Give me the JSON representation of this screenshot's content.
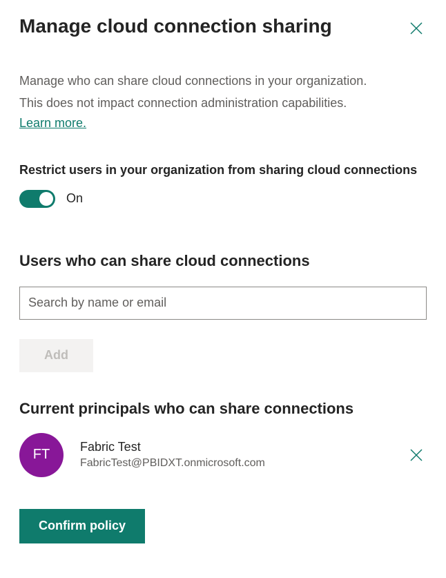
{
  "header": {
    "title": "Manage cloud connection sharing"
  },
  "description": {
    "line1": "Manage who can share cloud connections in your organization.",
    "line2": "This does not impact connection administration capabilities.",
    "learn_more": "Learn more."
  },
  "restrict": {
    "label": "Restrict users in your organization from sharing cloud connections",
    "state": "On"
  },
  "users_section": {
    "heading": "Users who can share cloud connections",
    "search_placeholder": "Search by name or email",
    "add_label": "Add"
  },
  "principals_section": {
    "heading": "Current principals who can share connections",
    "items": [
      {
        "initials": "FT",
        "name": "Fabric Test",
        "email": "FabricTest@PBIDXT.onmicrosoft.com"
      }
    ]
  },
  "footer": {
    "confirm_label": "Confirm policy"
  }
}
